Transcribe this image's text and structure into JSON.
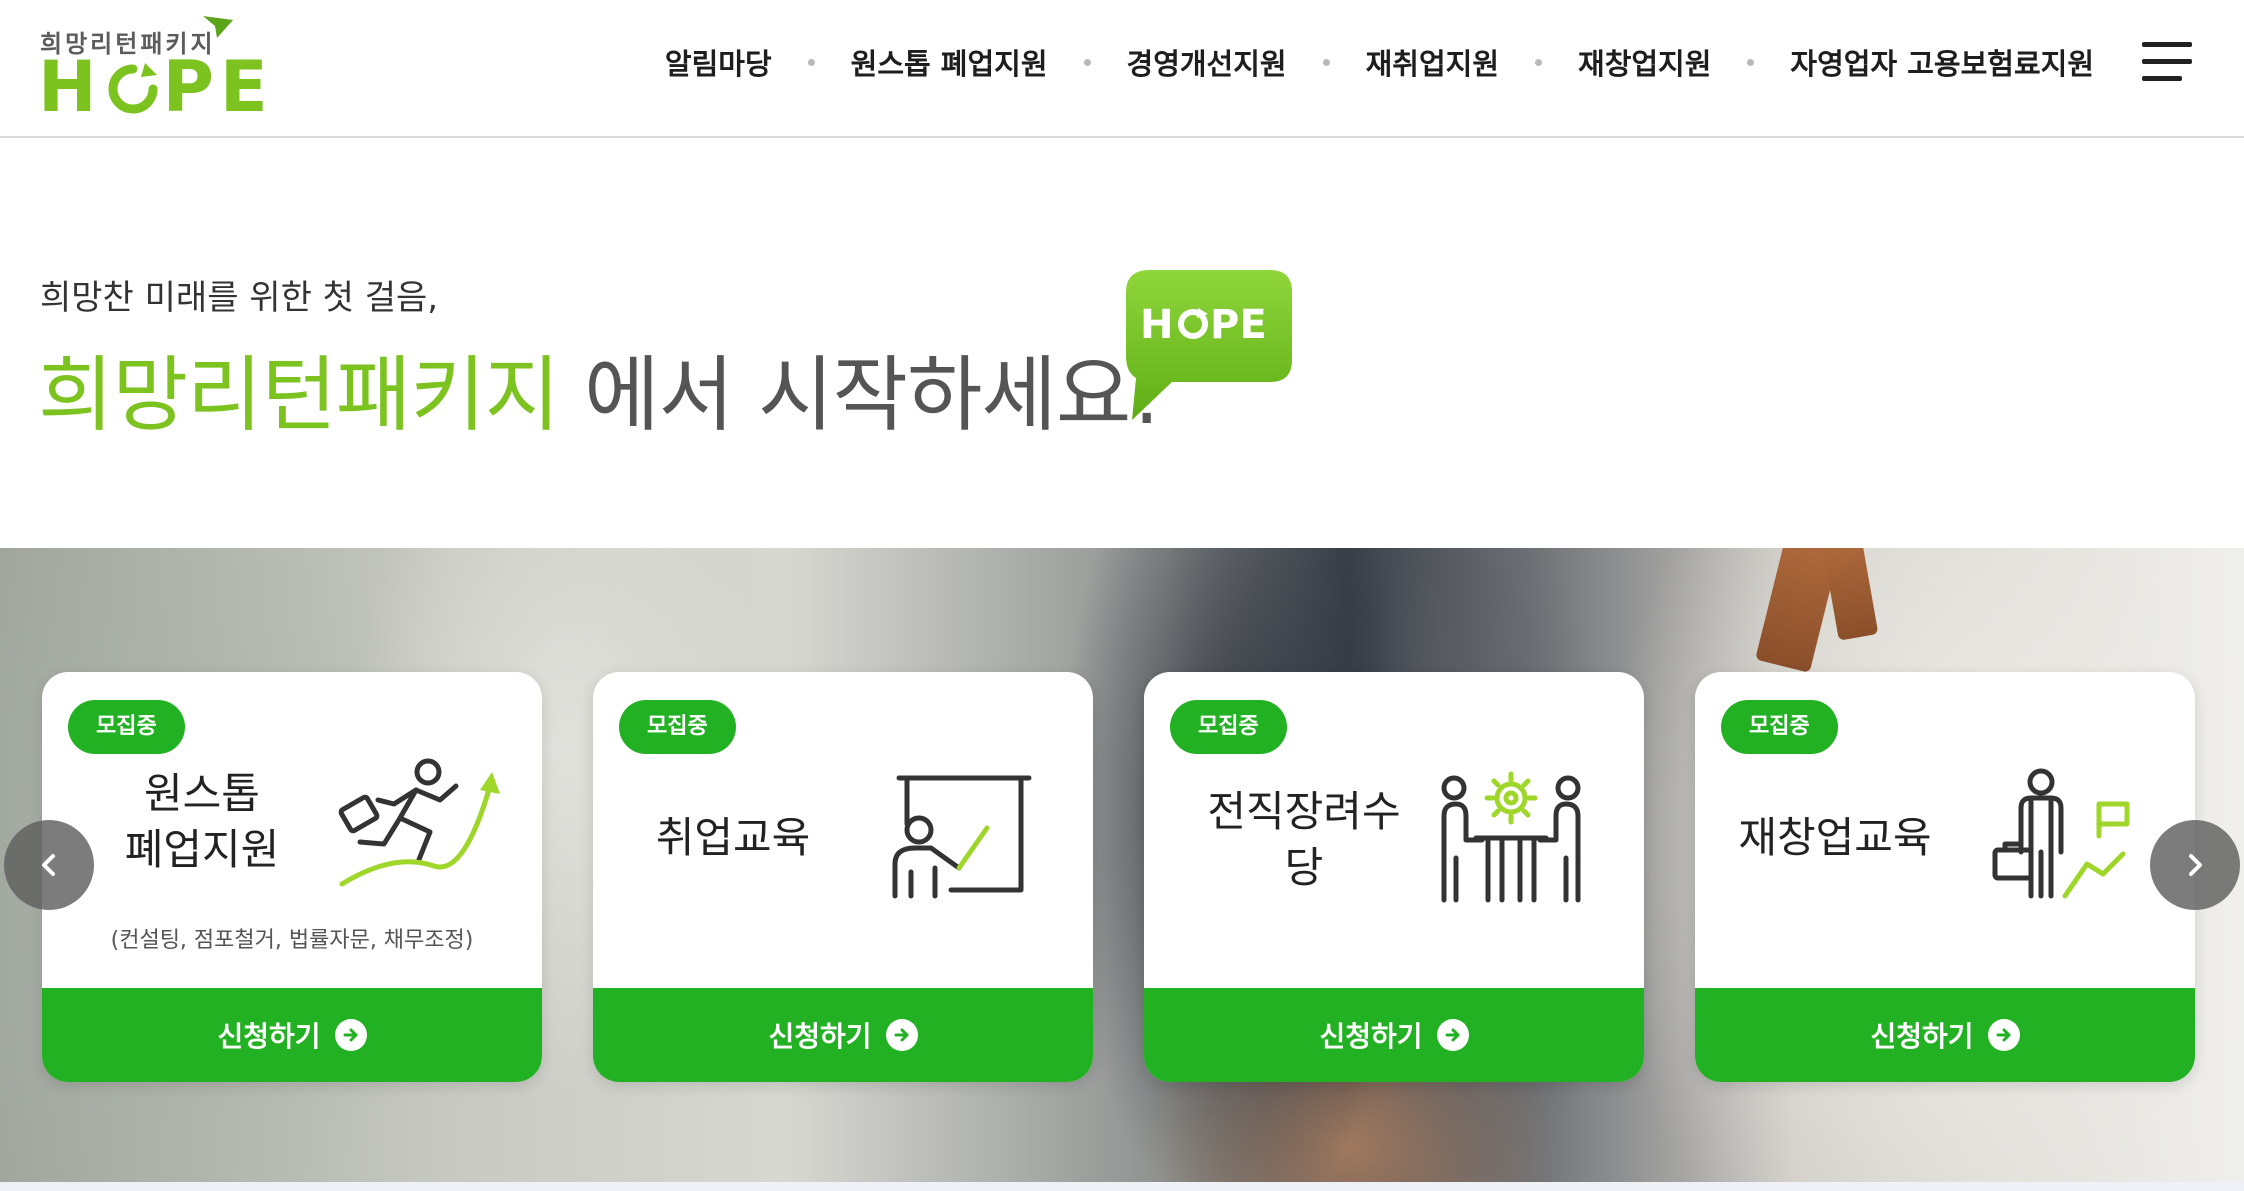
{
  "logo": {
    "subtitle": "희망리턴패키지",
    "word_left": "H",
    "word_right": "PE"
  },
  "nav": {
    "items": [
      {
        "label": "알림마당"
      },
      {
        "label": "원스톱 폐업지원"
      },
      {
        "label": "경영개선지원"
      },
      {
        "label": "재취업지원"
      },
      {
        "label": "재창업지원"
      },
      {
        "label": "자영업자 고용보험료지원"
      }
    ],
    "menu_icon": "hamburger-icon"
  },
  "hero": {
    "line1": "희망찬 미래를 위한 첫 걸음,",
    "accent": "희망리턴패키지",
    "rest": " 에서 시작하세요!",
    "bubble_text_left": "H",
    "bubble_text_right": "PE"
  },
  "cards": [
    {
      "badge": "모집중",
      "title": "원스톱\n폐업지원",
      "note": "(컨설팅, 점포철거, 법률자문, 채무조정)",
      "button": "신청하기",
      "icon": "running-businessman-icon"
    },
    {
      "badge": "모집중",
      "title": "취업교육",
      "note": "",
      "button": "신청하기",
      "icon": "presentation-board-icon"
    },
    {
      "badge": "모집중",
      "title": "전직장려수\n당",
      "note": "",
      "button": "신청하기",
      "icon": "meeting-gear-icon"
    },
    {
      "badge": "모집중",
      "title": "재창업교육",
      "note": "",
      "button": "신청하기",
      "icon": "businessman-flag-icon"
    }
  ],
  "slider": {
    "prev_icon": "chevron-left-icon",
    "next_icon": "chevron-right-icon"
  },
  "colors": {
    "brand_green": "#7cc31f",
    "button_green": "#23b124",
    "text_dark": "#222222"
  }
}
